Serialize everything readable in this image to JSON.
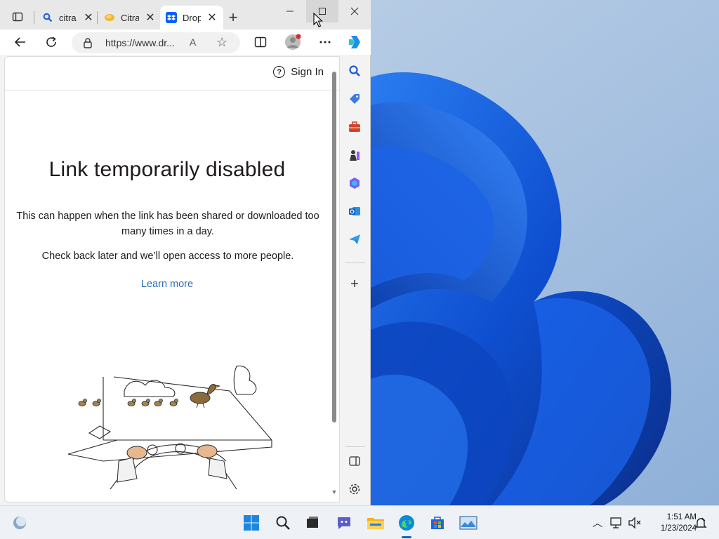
{
  "browser": {
    "tabs": [
      {
        "label": "citra",
        "icon": "search-icon",
        "close": "✕"
      },
      {
        "label": "Citra",
        "icon": "citra-icon",
        "close": "✕"
      },
      {
        "label": "Drop",
        "icon": "dropbox-icon",
        "close": "✕",
        "active": true
      }
    ],
    "new_tab": "+",
    "address": {
      "url": "https://www.dr...",
      "read_aloud": "A",
      "favorite": "☆"
    }
  },
  "page": {
    "signin_label": "Sign In",
    "headline": "Link temporarily disabled",
    "body1": "This can happen when the link has been shared or downloaded too many times in a day.",
    "body2": "Check back later and we’ll open access to more people.",
    "learn_more": "Learn more"
  },
  "sidebar": {
    "items": [
      "search-icon",
      "shopping-tag-icon",
      "tools-icon",
      "games-icon",
      "microsoft-365-icon",
      "outlook-icon",
      "telegram-icon"
    ],
    "add": "+"
  },
  "taskbar": {
    "time": "1:51 AM",
    "date": "1/23/2024"
  },
  "colors": {
    "link": "#2f6fb8",
    "edge_accent": "#0a64c8",
    "wallpaper_blue": "#1a5bd8"
  }
}
